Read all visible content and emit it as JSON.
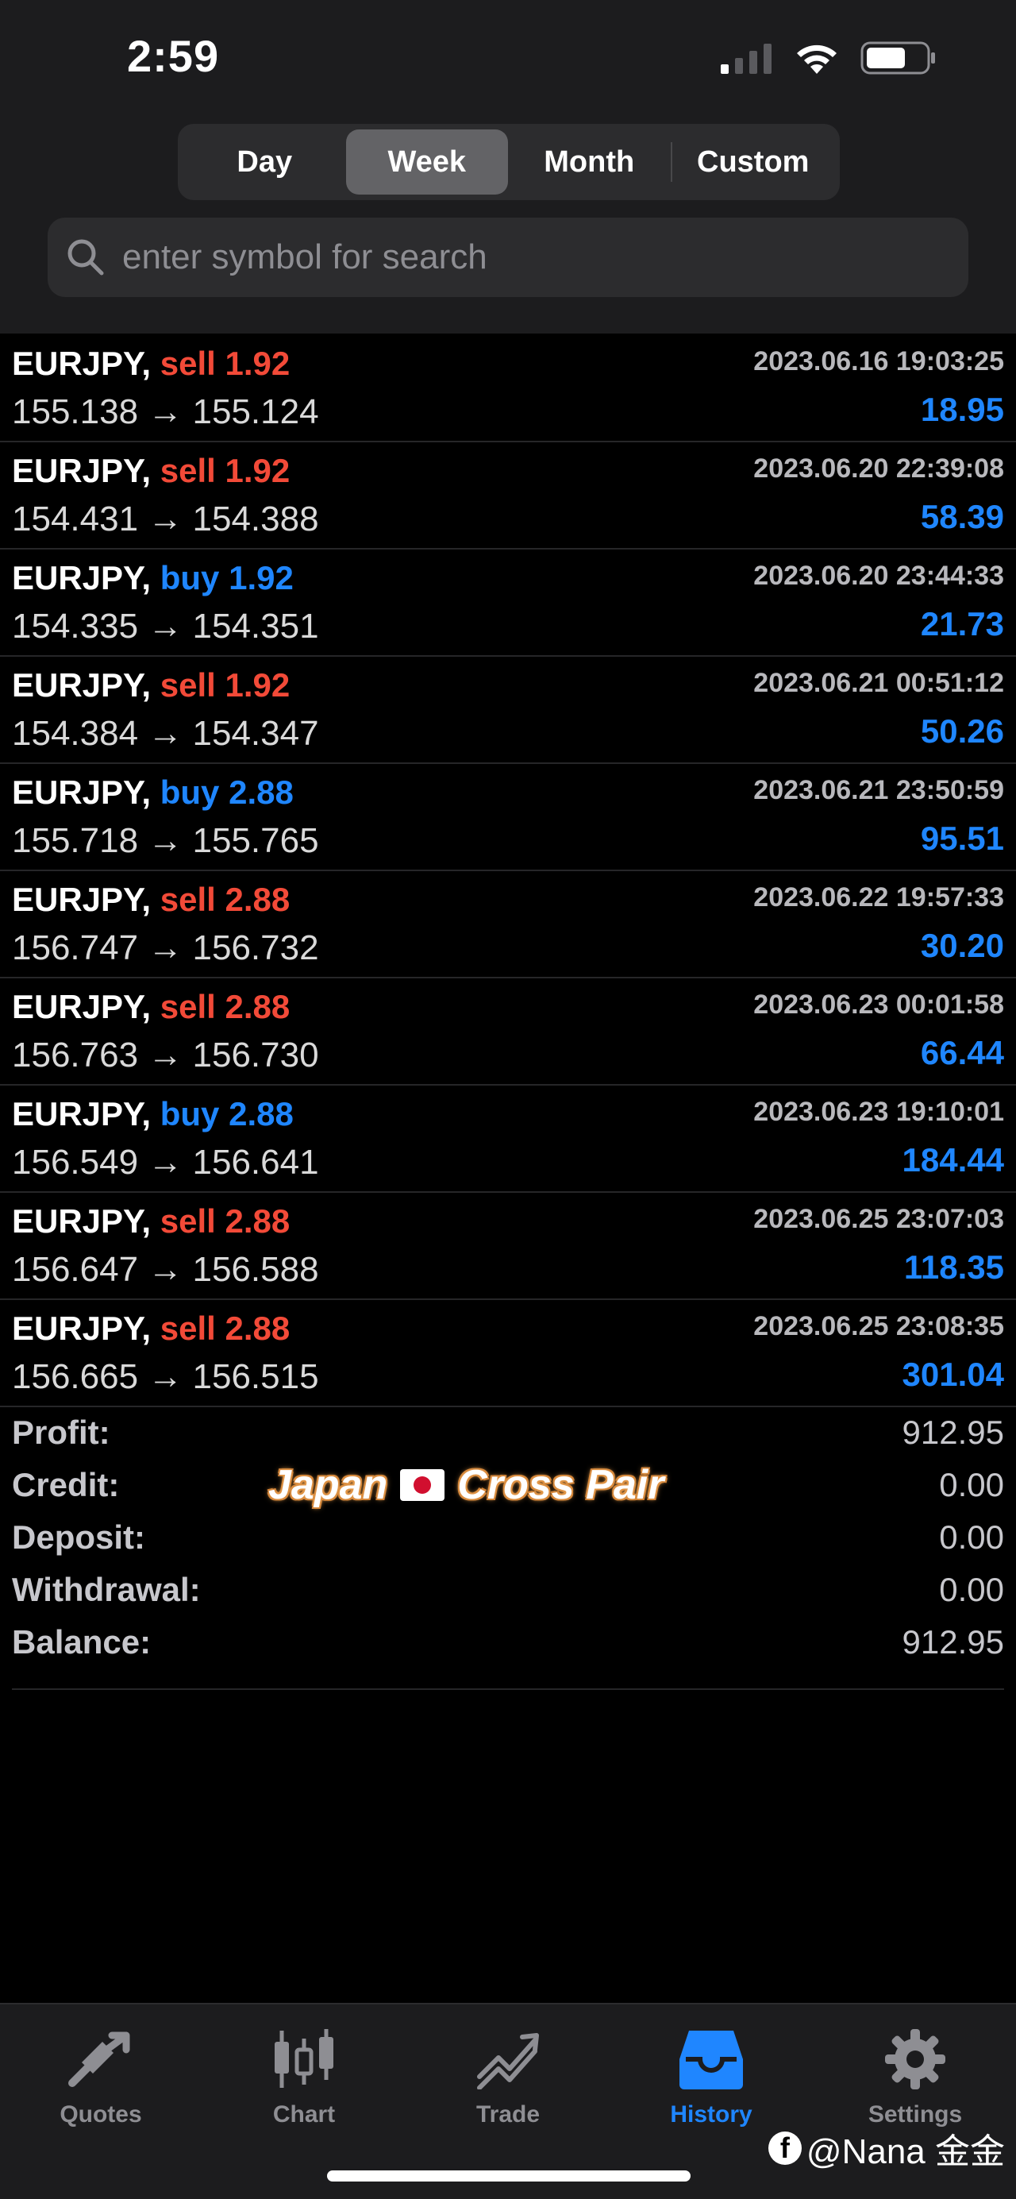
{
  "status_bar": {
    "time": "2:59"
  },
  "period_tabs": [
    {
      "label": "Day",
      "active": false
    },
    {
      "label": "Week",
      "active": true
    },
    {
      "label": "Month",
      "active": false
    },
    {
      "label": "Custom",
      "active": false
    }
  ],
  "search": {
    "placeholder": "enter symbol for search"
  },
  "trades": [
    {
      "symbol": "EURJPY,",
      "side": "sell",
      "volume": "1.92",
      "time": "2023.06.16 19:03:25",
      "prices": "155.138 → 155.124",
      "profit": "18.95"
    },
    {
      "symbol": "EURJPY,",
      "side": "sell",
      "volume": "1.92",
      "time": "2023.06.20 22:39:08",
      "prices": "154.431 → 154.388",
      "profit": "58.39"
    },
    {
      "symbol": "EURJPY,",
      "side": "buy",
      "volume": "1.92",
      "time": "2023.06.20 23:44:33",
      "prices": "154.335 → 154.351",
      "profit": "21.73"
    },
    {
      "symbol": "EURJPY,",
      "side": "sell",
      "volume": "1.92",
      "time": "2023.06.21 00:51:12",
      "prices": "154.384 → 154.347",
      "profit": "50.26"
    },
    {
      "symbol": "EURJPY,",
      "side": "buy",
      "volume": "2.88",
      "time": "2023.06.21 23:50:59",
      "prices": "155.718 → 155.765",
      "profit": "95.51"
    },
    {
      "symbol": "EURJPY,",
      "side": "sell",
      "volume": "2.88",
      "time": "2023.06.22 19:57:33",
      "prices": "156.747 → 156.732",
      "profit": "30.20"
    },
    {
      "symbol": "EURJPY,",
      "side": "sell",
      "volume": "2.88",
      "time": "2023.06.23 00:01:58",
      "prices": "156.763 → 156.730",
      "profit": "66.44"
    },
    {
      "symbol": "EURJPY,",
      "side": "buy",
      "volume": "2.88",
      "time": "2023.06.23 19:10:01",
      "prices": "156.549 → 156.641",
      "profit": "184.44"
    },
    {
      "symbol": "EURJPY,",
      "side": "sell",
      "volume": "2.88",
      "time": "2023.06.25 23:07:03",
      "prices": "156.647 → 156.588",
      "profit": "118.35"
    },
    {
      "symbol": "EURJPY,",
      "side": "sell",
      "volume": "2.88",
      "time": "2023.06.25 23:08:35",
      "prices": "156.665 → 156.515",
      "profit": "301.04"
    }
  ],
  "summary": [
    {
      "label": "Profit:",
      "value": "912.95"
    },
    {
      "label": "Credit:",
      "value": "0.00"
    },
    {
      "label": "Deposit:",
      "value": "0.00"
    },
    {
      "label": "Withdrawal:",
      "value": "0.00"
    },
    {
      "label": "Balance:",
      "value": "912.95"
    }
  ],
  "overlay": {
    "part1": "Japan",
    "part2": "Cross Pair"
  },
  "tab_bar": [
    {
      "label": "Quotes",
      "icon": "quotes-icon",
      "active": false
    },
    {
      "label": "Chart",
      "icon": "chart-icon",
      "active": false
    },
    {
      "label": "Trade",
      "icon": "trade-icon",
      "active": false
    },
    {
      "label": "History",
      "icon": "history-icon",
      "active": true
    },
    {
      "label": "Settings",
      "icon": "settings-icon",
      "active": false
    }
  ],
  "watermark": {
    "text": "@Nana 金金"
  },
  "colors": {
    "sell": "#f24a38",
    "buy": "#1f86ff",
    "profit": "#1f86ff",
    "active_tab": "#1f86ff"
  }
}
